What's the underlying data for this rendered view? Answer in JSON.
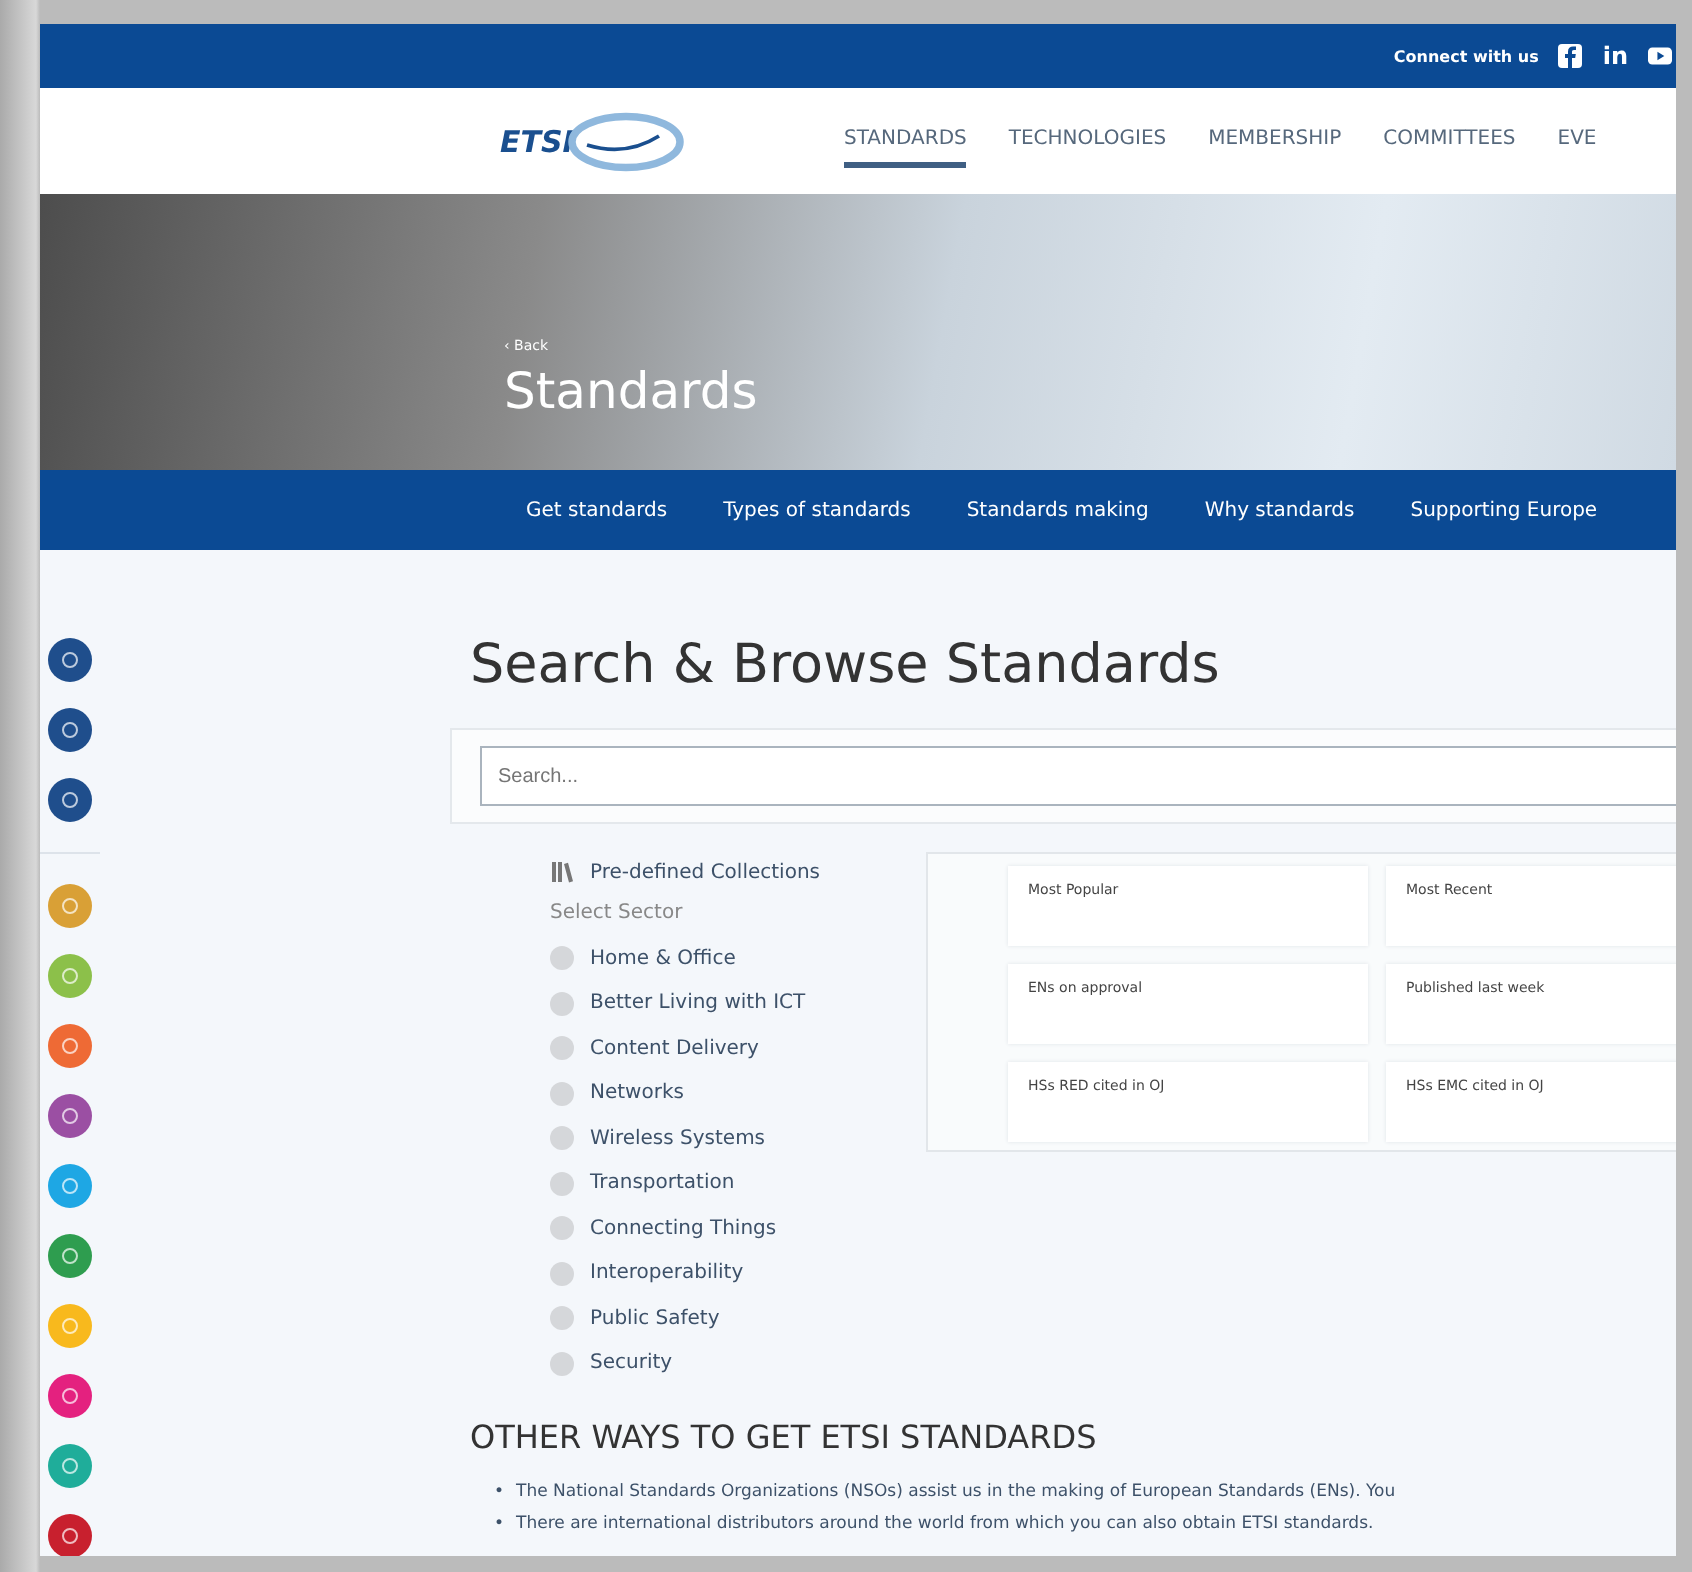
{
  "top_bar": {
    "connect_label": "Connect with us",
    "linkedin": "in"
  },
  "header": {
    "logo": "ETSI",
    "nav": [
      {
        "label": "STANDARDS",
        "selected": true
      },
      {
        "label": "TECHNOLOGIES",
        "selected": false
      },
      {
        "label": "MEMBERSHIP",
        "selected": false
      },
      {
        "label": "COMMITTEES",
        "selected": false
      },
      {
        "label": "EVE",
        "selected": false
      }
    ]
  },
  "hero": {
    "back_arrow": "‹",
    "back": "Back",
    "title": "Standards"
  },
  "subnav": [
    "Get standards",
    "Types of standards",
    "Standards making",
    "Why standards",
    "Supporting Europe"
  ],
  "side_icons": {
    "top": [
      {
        "color": "#1f4e8c"
      },
      {
        "color": "#1f4e8c"
      },
      {
        "color": "#1f4e8c"
      }
    ],
    "sectors": [
      {
        "color": "#d9a036"
      },
      {
        "color": "#8cc04a"
      },
      {
        "color": "#ee6a35"
      },
      {
        "color": "#9b4fa3"
      },
      {
        "color": "#1ea7e4"
      },
      {
        "color": "#2e9d4f"
      },
      {
        "color": "#f8b91d"
      },
      {
        "color": "#e4217f"
      },
      {
        "color": "#1fad9a"
      },
      {
        "color": "#c8202e"
      }
    ]
  },
  "search": {
    "title": "Search & Browse Standards",
    "placeholder": "Search..."
  },
  "collections": {
    "label": "Pre-defined Collections",
    "cards": [
      "Most Popular",
      "Most Recent",
      "ENs on approval",
      "Published last week",
      "HSs RED cited in OJ",
      "HSs EMC cited in OJ"
    ]
  },
  "sectors": {
    "label": "Select Sector",
    "items": [
      {
        "label": "Home & Office",
        "selected": false
      },
      {
        "label": "Better Living with ICT",
        "selected": false
      },
      {
        "label": "Content Delivery",
        "selected": false
      },
      {
        "label": "Networks",
        "selected": false
      },
      {
        "label": "Wireless Systems",
        "selected": false
      },
      {
        "label": "Transportation",
        "selected": false
      },
      {
        "label": "Connecting Things",
        "selected": false
      },
      {
        "label": "Interoperability",
        "selected": false
      },
      {
        "label": "Public Safety",
        "selected": false
      },
      {
        "label": "Security",
        "selected": false
      }
    ]
  },
  "other_ways": {
    "title": "OTHER WAYS TO GET ETSI STANDARDS",
    "items": [
      {
        "marker": "•",
        "text": "The National Standards Organizations (NSOs) assist us in the making of European Standards (ENs). You"
      },
      {
        "marker": "•",
        "text": "There are international distributors around the world from which you can also obtain ETSI standards."
      }
    ]
  }
}
